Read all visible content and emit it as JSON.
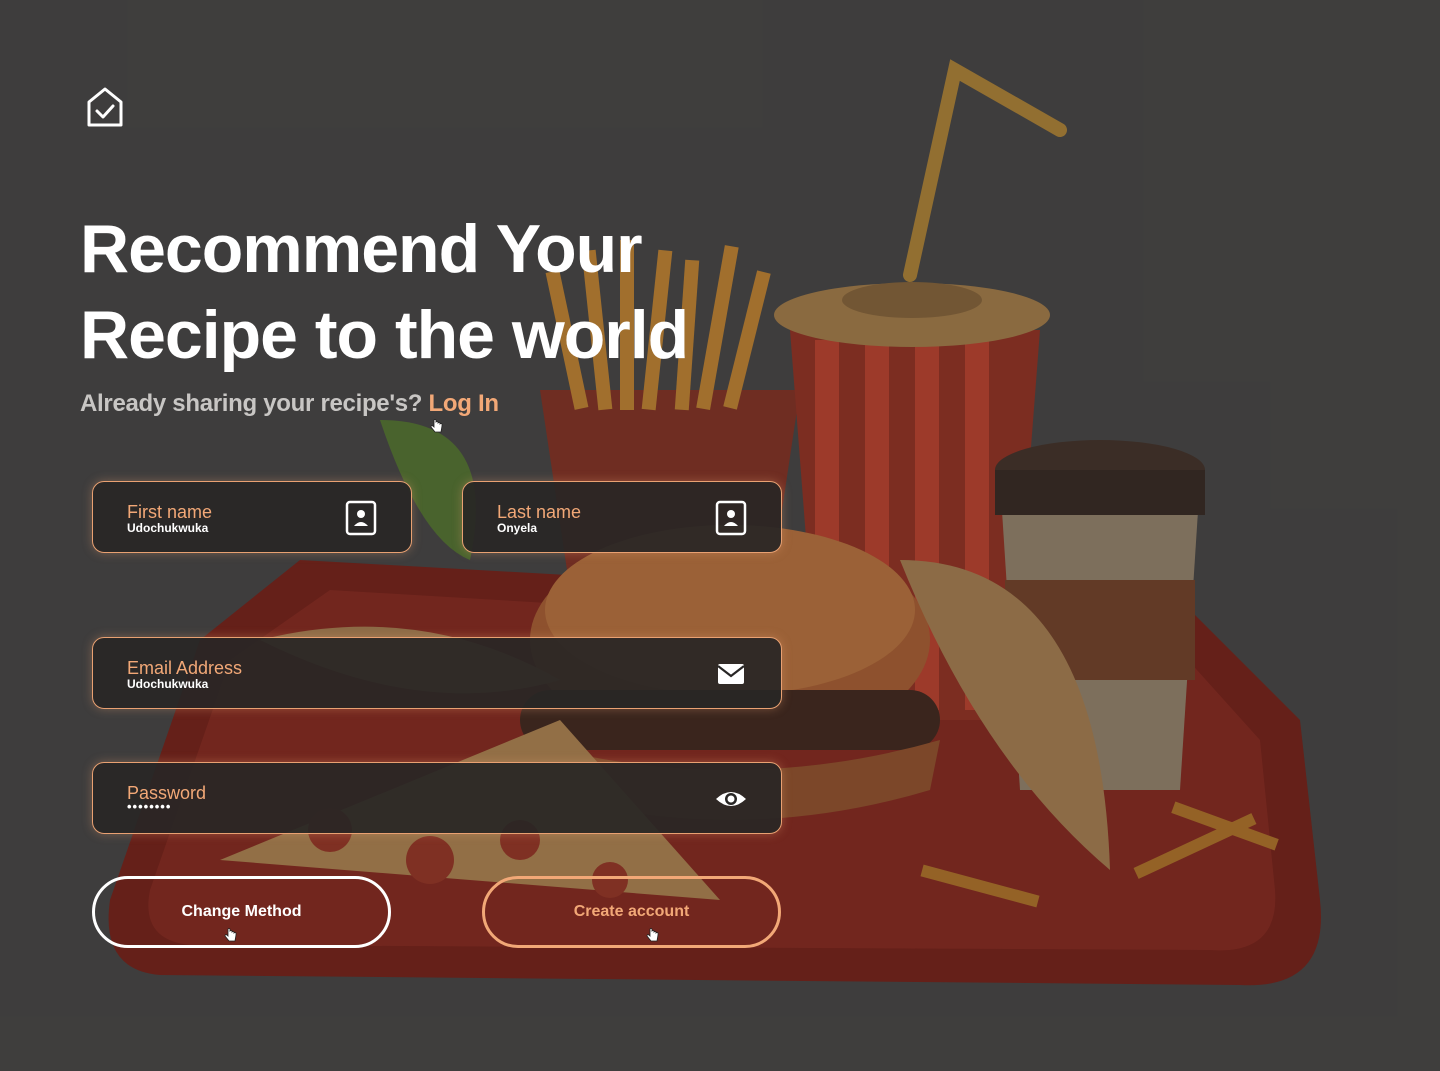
{
  "header": {
    "headline_line1": "Recommend Your",
    "headline_line2": "Recipe to the world",
    "subline_text": "Already sharing your recipe's?",
    "login_link": "Log In",
    "logo_icon": "home-check-icon"
  },
  "form": {
    "first_name": {
      "label": "First name",
      "value": "Udochukwuka",
      "icon": "contact-card-icon"
    },
    "last_name": {
      "label": "Last name",
      "value": "Onyela",
      "icon": "contact-card-icon"
    },
    "email": {
      "label": "Email Address",
      "value": "Udochukwuka",
      "icon": "envelope-icon"
    },
    "password": {
      "label": "Password",
      "value": "••••••••",
      "icon": "eye-icon"
    }
  },
  "actions": {
    "change_method": "Change Method",
    "create_account": "Create account"
  },
  "colors": {
    "background": "#3f3e3d",
    "accent": "#f2a877",
    "field_bg": "#282625"
  }
}
